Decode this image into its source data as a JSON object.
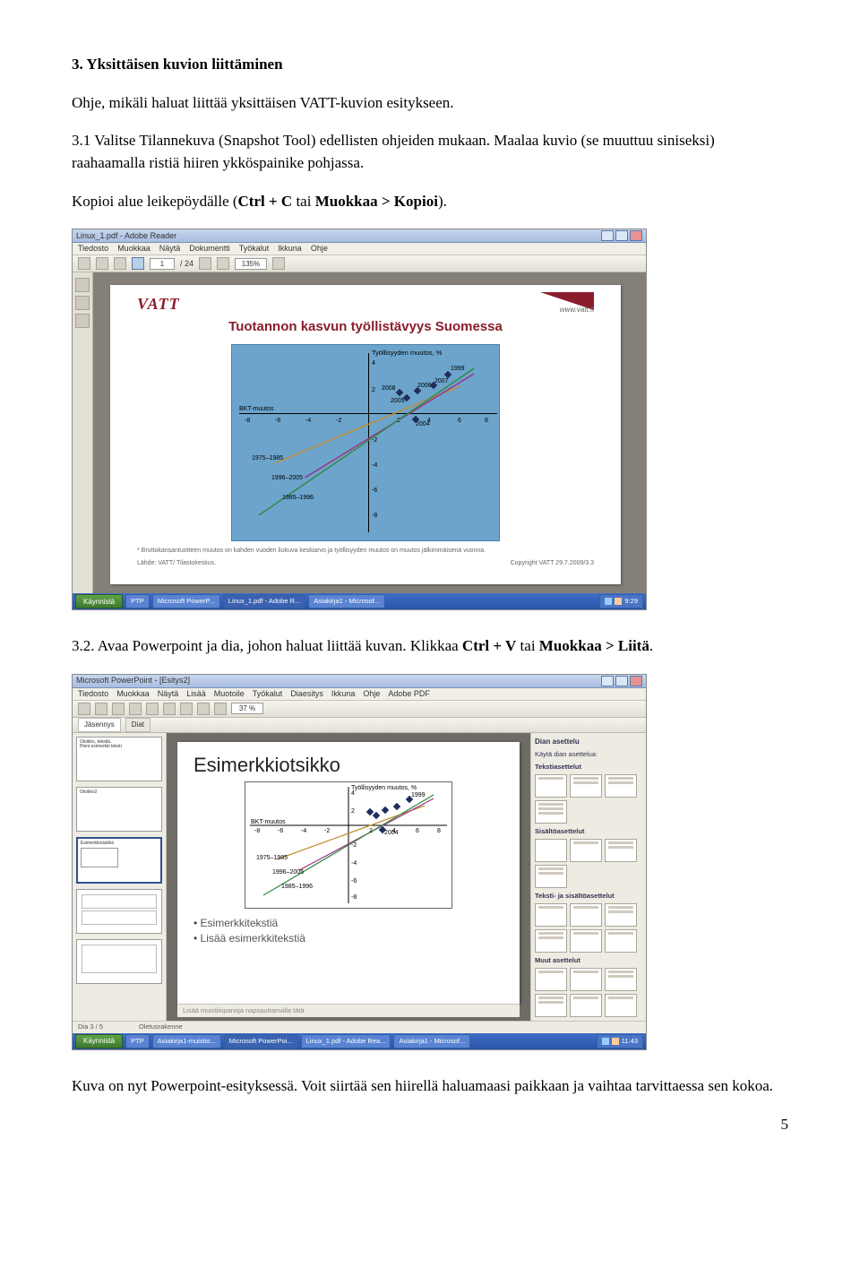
{
  "heading": "3. Yksittäisen kuvion liittäminen",
  "para1": "Ohje, mikäli haluat liittää yksittäisen VATT-kuvion esitykseen.",
  "para2_pre": "3.1 Valitse Tilannekuva (Snapshot Tool) edellisten ohjeiden mukaan.  Maalaa kuvio (se muuttuu siniseksi) raahaamalla ristiä hiiren ykköspainike pohjassa.",
  "para3_pre": "Kopioi alue leikepöydälle (",
  "para3_bold": "Ctrl + C",
  "para3_mid": " tai ",
  "para3_bold2": "Muokkaa > Kopioi",
  "para3_post": ").",
  "para4_pre": "3.2. Avaa Powerpoint ja dia, johon haluat liittää kuvan. Klikkaa ",
  "para4_bold1": "Ctrl + V",
  "para4_mid": " tai ",
  "para4_bold2": "Muokkaa > Liitä",
  "para4_post": ".",
  "para5": "Kuva on nyt Powerpoint-esityksessä. Voit siirtää sen hiirellä haluamaasi paikkaan ja vaihtaa tarvittaessa sen kokoa.",
  "page_number": "5",
  "ss1": {
    "title": "Linux_1.pdf - Adobe Reader",
    "menus": [
      "Tiedosto",
      "Muokkaa",
      "Näytä",
      "Dokumentti",
      "Työkalut",
      "Ikkuna",
      "Ohje"
    ],
    "page_current": "1",
    "page_total": "/ 24",
    "zoom": "135%",
    "logo": "VATT",
    "weburl": "www.vatt.fi",
    "slide_title": "Tuotannon kasvun työllistävyys Suomessa",
    "y_axis_label": "Työllisyyden muutos, %",
    "x_axis_label": "BKT-muutos",
    "footnote": "* Bruttokansantuotteen muutos on kahden vuoden liukuva keskiarvo ja työllisyyden muutos   on muutos jälkimmäisenä vuonna.",
    "source": "Lähde: VATT/ Tilastokeskus.",
    "copyright": "Copyright VATT 29.7.2009/3.3",
    "ticks_y": [
      "4",
      "2",
      "-2",
      "-4",
      "-6",
      "-8"
    ],
    "ticks_x": [
      "-8",
      "-6",
      "-4",
      "-2",
      "2",
      "4",
      "6",
      "8"
    ],
    "line_labels": [
      "1975–1985",
      "1996–2005",
      "1985–1996"
    ],
    "point_labels": [
      "1999",
      "2007",
      "2006",
      "2008",
      "2005",
      "2004"
    ],
    "start": "Käynnistä",
    "taskbtns": [
      "PTP",
      "Microsoft PowerP...",
      "Linux_1.pdf - Adobe R...",
      "Asiakirja1 - Microsof..."
    ],
    "tray_time": "9:29"
  },
  "chart_data": {
    "type": "scatter",
    "title": "Tuotannon kasvun työllistävyys Suomessa",
    "xlabel": "BKT-muutos",
    "ylabel": "Työllisyyden muutos, %",
    "xlim": [
      -8,
      8
    ],
    "ylim": [
      -8,
      4
    ],
    "series": [
      {
        "name": "points",
        "points": [
          {
            "label": "2004",
            "x": 3.0,
            "y": -0.5
          },
          {
            "label": "2005",
            "x": 2.5,
            "y": 1.3
          },
          {
            "label": "2008",
            "x": 2.0,
            "y": 1.7
          },
          {
            "label": "2006",
            "x": 3.2,
            "y": 1.8
          },
          {
            "label": "2007",
            "x": 4.2,
            "y": 2.2
          },
          {
            "label": "1999",
            "x": 5.0,
            "y": 3.0
          }
        ]
      }
    ],
    "trend_lines": [
      {
        "name": "1975–1985",
        "x1": -6,
        "y1": -4,
        "x2": 6,
        "y2": 2
      },
      {
        "name": "1996–2005",
        "x1": -4,
        "y1": -5,
        "x2": 7,
        "y2": 3
      },
      {
        "name": "1985–1996",
        "x1": -7,
        "y1": -8,
        "x2": 7,
        "y2": 3.5
      }
    ]
  },
  "ss2": {
    "title": "Microsoft PowerPoint - [Esitys2]",
    "menus": [
      "Tiedosto",
      "Muokkaa",
      "Näytä",
      "Lisää",
      "Muotoile",
      "Työkalut",
      "Diaesitys",
      "Ikkuna",
      "Ohje",
      "Adobe PDF"
    ],
    "zoom": "37 %",
    "tabs": [
      "Jäsennys",
      "Diat"
    ],
    "slide_title": "Esimerkkiotsikko",
    "bullet1": "Esimerkkitekstiä",
    "bullet2": "Lisää esimerkkitekstiä",
    "notes_hint": "Lisää muistiinpanoja napsauttamalla tätä",
    "status_left": "Dia 3 / 5",
    "status_mid": "Oletusrakenne",
    "rp_title": "Dian asettelu",
    "rp_link": "Käytä dian asettelua:",
    "sect1": "Tekstiasettelut",
    "sect2": "Sisältöasettelut",
    "sect3": "Teksti- ja sisältöasettelut",
    "sect4": "Muut asettelut",
    "tray_time": "11:43",
    "start": "Käynnistä",
    "taskbtns": [
      "PTP",
      "Asiakirja1-muistio...",
      "Microsoft PowerPoi...",
      "Linux_1.pdf - Adobe Rea...",
      "Asiakirja1 - Microsof..."
    ]
  }
}
